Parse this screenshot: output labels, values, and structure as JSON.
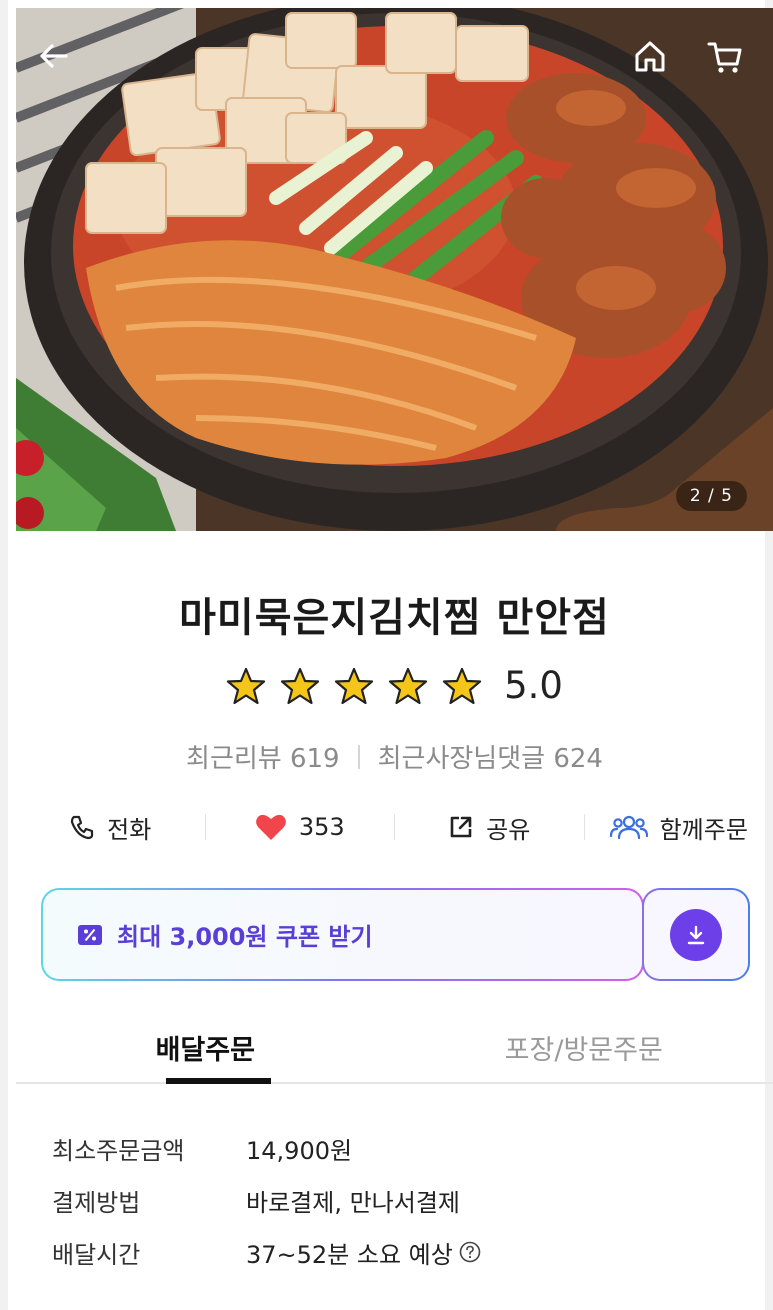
{
  "hero": {
    "pager": "2 / 5",
    "icons": {
      "back": "arrow-left-icon",
      "home": "home-icon",
      "cart": "cart-icon"
    }
  },
  "store": {
    "name": "마미묵은지김치찜 만안점",
    "rating": 5.0,
    "rating_text": "5.0",
    "recent_reviews": "최근리뷰 619",
    "owner_replies": "최근사장님댓글 624"
  },
  "actions": [
    {
      "label": "전화",
      "icon": "phone-icon"
    },
    {
      "label": "353",
      "icon": "heart-icon"
    },
    {
      "label": "공유",
      "icon": "share-icon"
    },
    {
      "label": "함께주문",
      "icon": "group-icon"
    }
  ],
  "coupon": {
    "label": "최대 3,000원 쿠폰 받기",
    "icon": "coupon-percent-icon",
    "download_icon": "download-icon"
  },
  "tabs": [
    {
      "label": "배달주문",
      "active": true
    },
    {
      "label": "포장/방문주문",
      "active": false
    }
  ],
  "info": [
    {
      "label": "최소주문금액",
      "value": "14,900원"
    },
    {
      "label": "결제방법",
      "value": "바로결제, 만나서결제"
    },
    {
      "label": "배달시간",
      "value": "37~52분 소요 예상"
    }
  ],
  "colors": {
    "accent_purple": "#6d3fe8",
    "coupon_text": "#5a3fd6",
    "star": "#f5c518",
    "heart": "#f0454b",
    "group_icon": "#3b6fe0"
  }
}
